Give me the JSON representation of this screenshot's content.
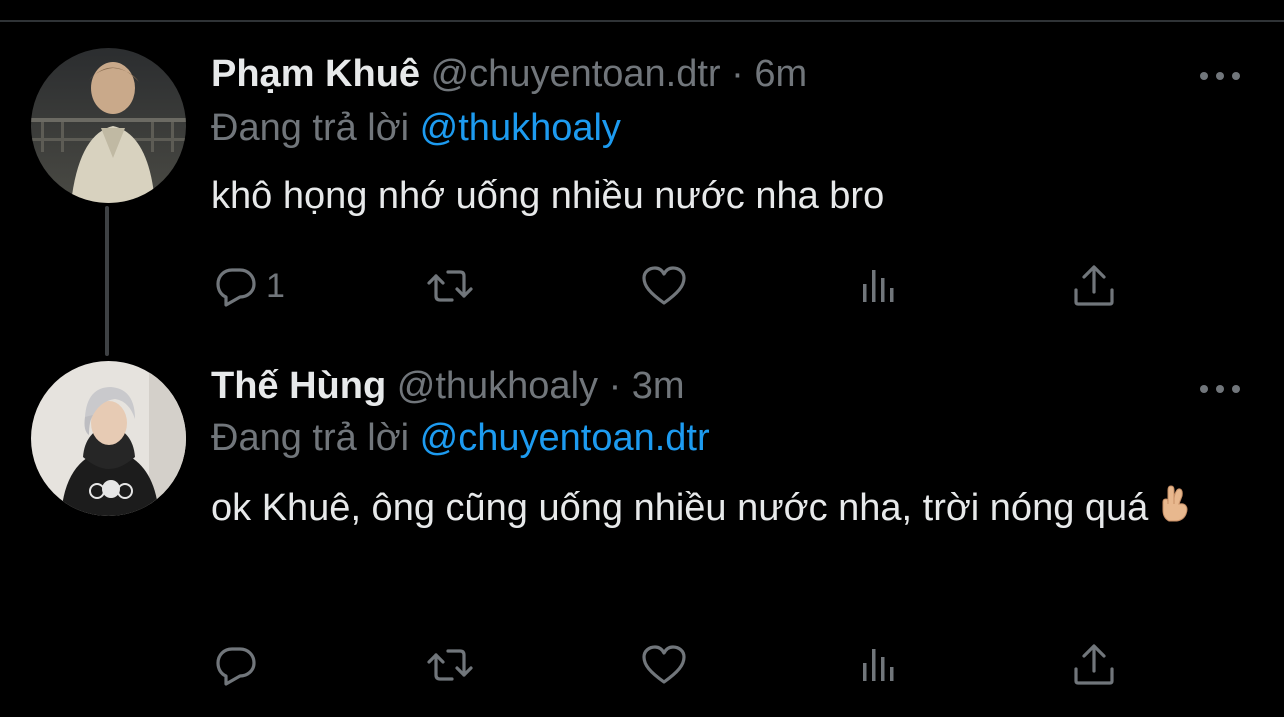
{
  "tweets": [
    {
      "name": "Phạm Khuê",
      "handle": "@chuyentoan.dtr",
      "separator": "·",
      "time": "6m",
      "replying_prefix": "Đang trả lời",
      "replying_to": "@thukhoaly",
      "text": "khô họng nhớ uống nhiều nước nha bro",
      "reply_count": "1"
    },
    {
      "name": "Thế Hùng",
      "handle": "@thukhoaly",
      "separator": "·",
      "time": "3m",
      "replying_prefix": "Đang trả lời",
      "replying_to": "@chuyentoan.dtr",
      "text": "ok Khuê, ông cũng uống nhiều nước nha, trời nóng quá",
      "reply_count": ""
    }
  ],
  "icons": {
    "reply": "reply-icon",
    "retweet": "retweet-icon",
    "like": "heart-icon",
    "views": "views-icon",
    "share": "share-icon",
    "more": "more-icon",
    "emoji": "crossed-fingers-emoji"
  },
  "colors": {
    "background": "#000000",
    "text": "#e7e9ea",
    "secondary": "#71767b",
    "accent": "#1d9bf0",
    "divider": "#2f3336"
  }
}
